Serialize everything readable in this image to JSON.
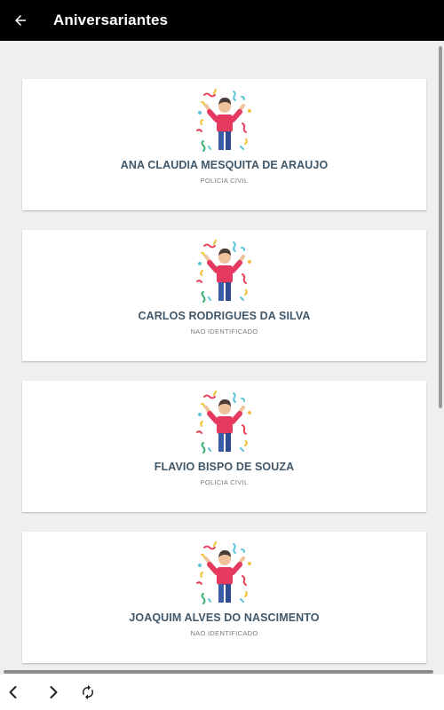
{
  "header": {
    "title": "Aniversariantes",
    "back_icon": "arrow-left-icon"
  },
  "birthdays": [
    {
      "name": "ANA CLAUDIA MESQUITA DE ARAUJO",
      "organization": "POLICIA CIVIL",
      "illustration": "celebration-person-icon"
    },
    {
      "name": "CARLOS RODRIGUES DA SILVA",
      "organization": "NAO IDENTIFICADO",
      "illustration": "celebration-person-icon"
    },
    {
      "name": "FLAVIO BISPO DE SOUZA",
      "organization": "POLICIA CIVIL",
      "illustration": "celebration-person-icon"
    },
    {
      "name": "JOAQUIM ALVES DO NASCIMENTO",
      "organization": "NAO IDENTIFICADO",
      "illustration": "celebration-person-icon"
    }
  ],
  "bottom_nav": {
    "back_icon": "chevron-left-icon",
    "forward_icon": "chevron-right-icon",
    "reload_icon": "refresh-icon"
  },
  "colors": {
    "header_bg": "#000000",
    "content_bg": "#eeeff1",
    "name_text": "#41586a",
    "org_text": "#7a7a7a"
  }
}
